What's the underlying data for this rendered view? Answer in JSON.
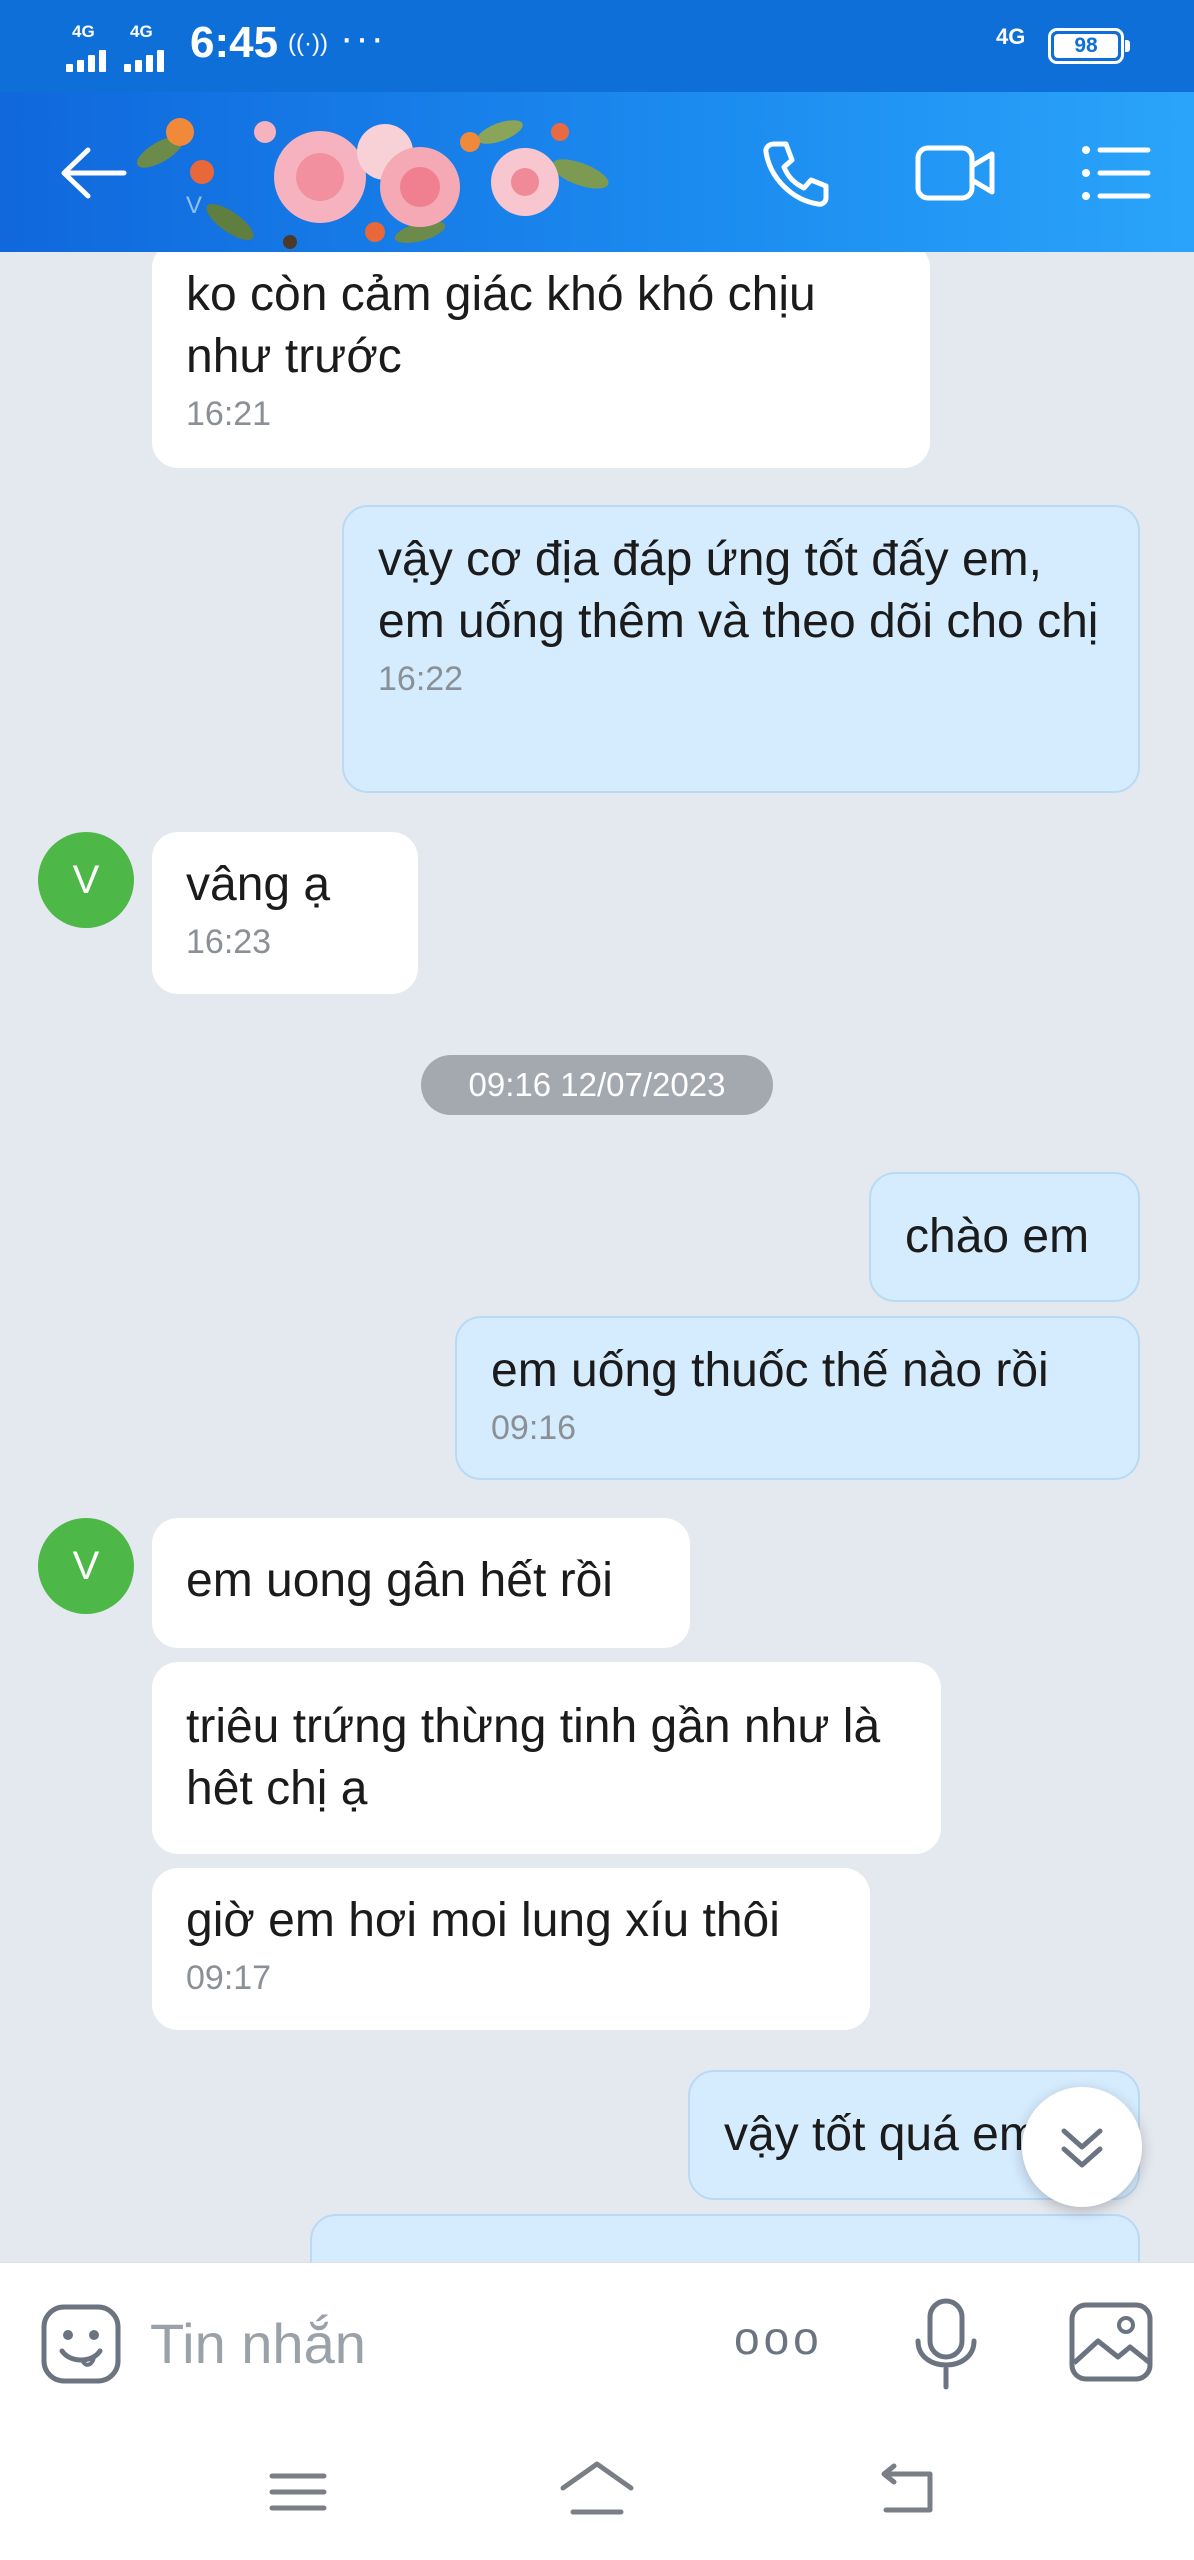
{
  "status_bar": {
    "signal1_label": "4G",
    "signal2_label": "4G",
    "time": "6:45",
    "hotspot_icon": "((·))",
    "more_dots": "···",
    "network_label": "4G",
    "battery_level": "98"
  },
  "header": {
    "contact_initial": "V",
    "icons": [
      "back-arrow-icon",
      "phone-call-icon",
      "video-call-icon",
      "menu-list-icon"
    ]
  },
  "messages": [
    {
      "side": "in",
      "text": "ko còn cảm giác khó khó chịu như trước",
      "time": "16:21"
    },
    {
      "side": "out",
      "text": "vậy cơ địa đáp ứng tốt đấy em, em uống thêm và theo dõi cho chị",
      "time": "16:22"
    },
    {
      "side": "in",
      "avatar": "V",
      "text": "vâng ạ",
      "time": "16:23"
    },
    {
      "side": "out",
      "text": "chào em"
    },
    {
      "side": "out",
      "text": "em uống thuốc thế nào rồi",
      "time": "09:16"
    },
    {
      "side": "in",
      "avatar": "V",
      "text": "em uong gân hết rồi"
    },
    {
      "side": "in",
      "text": "triêu trứng thừng tinh gần như là hêt chị ạ"
    },
    {
      "side": "in",
      "text": "giờ em hơi moi lung xíu thôi",
      "time": "09:17"
    },
    {
      "side": "out",
      "text": "vậy tốt quá em"
    }
  ],
  "date_separator": "09:16 12/07/2023",
  "composer": {
    "placeholder": "Tin nhắn",
    "more_icon": "ooo"
  },
  "colors": {
    "header_blue": "#1068dc",
    "incoming_bubble": "#ffffff",
    "outgoing_bubble": "#d5ecfe",
    "avatar_green": "#4db848",
    "chat_background": "#e4e8ef"
  }
}
